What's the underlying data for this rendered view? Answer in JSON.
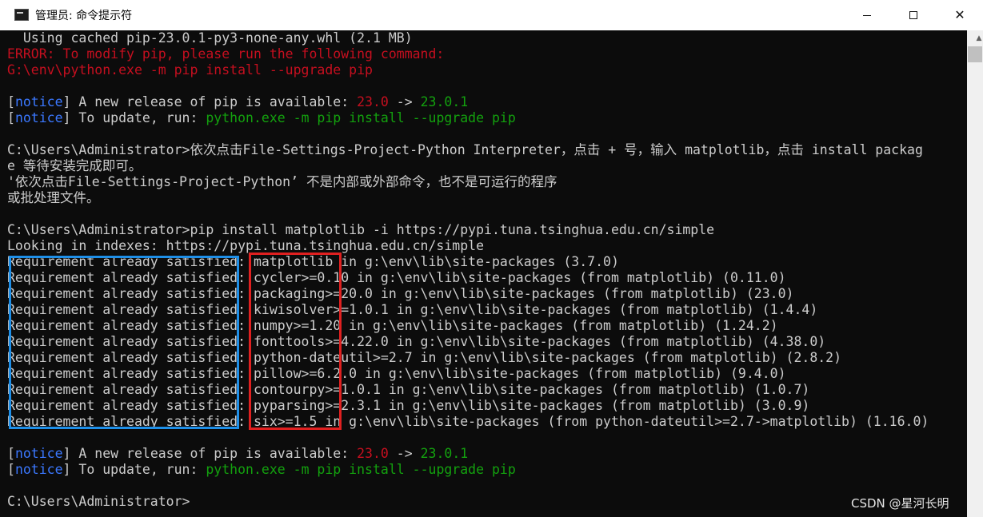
{
  "window": {
    "title": "管理员: 命令提示符",
    "minimize_glyph": "—",
    "maximize_glyph": "☐",
    "close_glyph": "✕"
  },
  "console": {
    "line_01": "  Using cached pip-23.0.1-py3-none-any.whl (2.1 MB)",
    "line_02": "ERROR: To modify pip, please run the following command:",
    "line_03": "G:\\env\\python.exe -m pip install --upgrade pip",
    "notice_1": {
      "bracket_open": "[",
      "tag": "notice",
      "text": "] A new release of pip is available: ",
      "old_version": "23.0",
      "arrow": " -> ",
      "new_version": "23.0.1"
    },
    "notice_2": {
      "bracket_open": "[",
      "tag": "notice",
      "text": "] To update, run: ",
      "command": "python.exe -m pip install --upgrade pip"
    },
    "line_08": "C:\\Users\\Administrator>依次点击File-Settings-Project-Python Interpreter，点击 + 号，输入 matplotlib，点击 install packag",
    "line_09": "e 等待安装完成即可。",
    "line_10": "'依次点击File-Settings-Project-Python’ 不是内部或外部命令，也不是可运行的程序",
    "line_11": "或批处理文件。",
    "line_13": "C:\\Users\\Administrator>pip install matplotlib -i https://pypi.tuna.tsinghua.edu.cn/simple",
    "line_14": "Looking in indexes: https://pypi.tuna.tsinghua.edu.cn/simple",
    "requirements": [
      "Requirement already satisfied: matplotlib in g:\\env\\lib\\site-packages (3.7.0)",
      "Requirement already satisfied: cycler>=0.10 in g:\\env\\lib\\site-packages (from matplotlib) (0.11.0)",
      "Requirement already satisfied: packaging>=20.0 in g:\\env\\lib\\site-packages (from matplotlib) (23.0)",
      "Requirement already satisfied: kiwisolver>=1.0.1 in g:\\env\\lib\\site-packages (from matplotlib) (1.4.4)",
      "Requirement already satisfied: numpy>=1.20 in g:\\env\\lib\\site-packages (from matplotlib) (1.24.2)",
      "Requirement already satisfied: fonttools>=4.22.0 in g:\\env\\lib\\site-packages (from matplotlib) (4.38.0)",
      "Requirement already satisfied: python-dateutil>=2.7 in g:\\env\\lib\\site-packages (from matplotlib) (2.8.2)",
      "Requirement already satisfied: pillow>=6.2.0 in g:\\env\\lib\\site-packages (from matplotlib) (9.4.0)",
      "Requirement already satisfied: contourpy>=1.0.1 in g:\\env\\lib\\site-packages (from matplotlib) (1.0.7)",
      "Requirement already satisfied: pyparsing>=2.3.1 in g:\\env\\lib\\site-packages (from matplotlib) (3.0.9)",
      "Requirement already satisfied: six>=1.5 in g:\\env\\lib\\site-packages (from python-dateutil>=2.7->matplotlib) (1.16.0)"
    ],
    "prompt": "C:\\Users\\Administrator>"
  },
  "watermark": "CSDN @星河长明",
  "colors": {
    "background": "#0c0c0c",
    "text": "#cccccc",
    "error": "#c50f1f",
    "success": "#13a10e",
    "notice": "#3b78ff",
    "highlight_blue": "#1e8fe8",
    "highlight_red": "#e02020"
  },
  "icons": [
    "cmd-icon",
    "minimize-icon",
    "maximize-icon",
    "close-icon",
    "scroll-up-icon"
  ]
}
